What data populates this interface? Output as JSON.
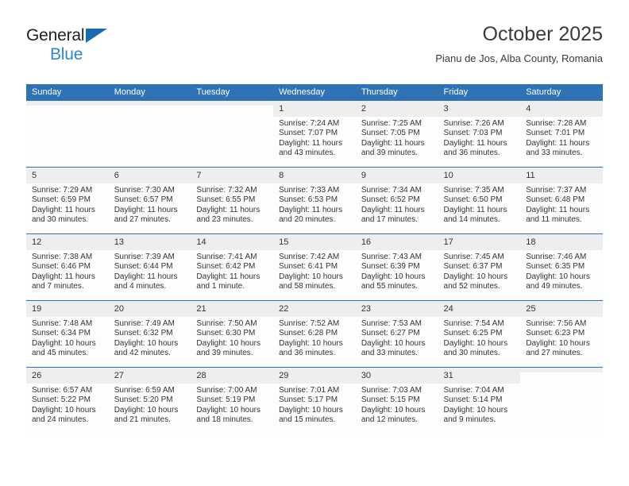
{
  "brand": {
    "name_top": "General",
    "name_bottom": "Blue",
    "triangle_color": "#1b68b3",
    "text_color_top": "#231f20",
    "text_color_bottom": "#2e86d4"
  },
  "header": {
    "title": "October 2025",
    "subtitle": "Pianu de Jos, Alba County, Romania"
  },
  "theme": {
    "header_bg": "#2f72b6",
    "header_text": "#ffffff",
    "daynum_bg": "#eeeeee",
    "cell_bg": "#fdfdfd",
    "border": "#2f72b6",
    "text": "#333333"
  },
  "weekdays": [
    "Sunday",
    "Monday",
    "Tuesday",
    "Wednesday",
    "Thursday",
    "Friday",
    "Saturday"
  ],
  "labels": {
    "sunrise": "Sunrise:",
    "sunset": "Sunset:",
    "daylight": "Daylight:"
  },
  "weeks": [
    [
      {
        "day": "",
        "empty": true
      },
      {
        "day": "",
        "empty": true
      },
      {
        "day": "",
        "empty": true
      },
      {
        "day": "1",
        "sunrise": "Sunrise: 7:24 AM",
        "sunset": "Sunset: 7:07 PM",
        "daylight": "Daylight: 11 hours and 43 minutes."
      },
      {
        "day": "2",
        "sunrise": "Sunrise: 7:25 AM",
        "sunset": "Sunset: 7:05 PM",
        "daylight": "Daylight: 11 hours and 39 minutes."
      },
      {
        "day": "3",
        "sunrise": "Sunrise: 7:26 AM",
        "sunset": "Sunset: 7:03 PM",
        "daylight": "Daylight: 11 hours and 36 minutes."
      },
      {
        "day": "4",
        "sunrise": "Sunrise: 7:28 AM",
        "sunset": "Sunset: 7:01 PM",
        "daylight": "Daylight: 11 hours and 33 minutes."
      }
    ],
    [
      {
        "day": "5",
        "sunrise": "Sunrise: 7:29 AM",
        "sunset": "Sunset: 6:59 PM",
        "daylight": "Daylight: 11 hours and 30 minutes."
      },
      {
        "day": "6",
        "sunrise": "Sunrise: 7:30 AM",
        "sunset": "Sunset: 6:57 PM",
        "daylight": "Daylight: 11 hours and 27 minutes."
      },
      {
        "day": "7",
        "sunrise": "Sunrise: 7:32 AM",
        "sunset": "Sunset: 6:55 PM",
        "daylight": "Daylight: 11 hours and 23 minutes."
      },
      {
        "day": "8",
        "sunrise": "Sunrise: 7:33 AM",
        "sunset": "Sunset: 6:53 PM",
        "daylight": "Daylight: 11 hours and 20 minutes."
      },
      {
        "day": "9",
        "sunrise": "Sunrise: 7:34 AM",
        "sunset": "Sunset: 6:52 PM",
        "daylight": "Daylight: 11 hours and 17 minutes."
      },
      {
        "day": "10",
        "sunrise": "Sunrise: 7:35 AM",
        "sunset": "Sunset: 6:50 PM",
        "daylight": "Daylight: 11 hours and 14 minutes."
      },
      {
        "day": "11",
        "sunrise": "Sunrise: 7:37 AM",
        "sunset": "Sunset: 6:48 PM",
        "daylight": "Daylight: 11 hours and 11 minutes."
      }
    ],
    [
      {
        "day": "12",
        "sunrise": "Sunrise: 7:38 AM",
        "sunset": "Sunset: 6:46 PM",
        "daylight": "Daylight: 11 hours and 7 minutes."
      },
      {
        "day": "13",
        "sunrise": "Sunrise: 7:39 AM",
        "sunset": "Sunset: 6:44 PM",
        "daylight": "Daylight: 11 hours and 4 minutes."
      },
      {
        "day": "14",
        "sunrise": "Sunrise: 7:41 AM",
        "sunset": "Sunset: 6:42 PM",
        "daylight": "Daylight: 11 hours and 1 minute."
      },
      {
        "day": "15",
        "sunrise": "Sunrise: 7:42 AM",
        "sunset": "Sunset: 6:41 PM",
        "daylight": "Daylight: 10 hours and 58 minutes."
      },
      {
        "day": "16",
        "sunrise": "Sunrise: 7:43 AM",
        "sunset": "Sunset: 6:39 PM",
        "daylight": "Daylight: 10 hours and 55 minutes."
      },
      {
        "day": "17",
        "sunrise": "Sunrise: 7:45 AM",
        "sunset": "Sunset: 6:37 PM",
        "daylight": "Daylight: 10 hours and 52 minutes."
      },
      {
        "day": "18",
        "sunrise": "Sunrise: 7:46 AM",
        "sunset": "Sunset: 6:35 PM",
        "daylight": "Daylight: 10 hours and 49 minutes."
      }
    ],
    [
      {
        "day": "19",
        "sunrise": "Sunrise: 7:48 AM",
        "sunset": "Sunset: 6:34 PM",
        "daylight": "Daylight: 10 hours and 45 minutes."
      },
      {
        "day": "20",
        "sunrise": "Sunrise: 7:49 AM",
        "sunset": "Sunset: 6:32 PM",
        "daylight": "Daylight: 10 hours and 42 minutes."
      },
      {
        "day": "21",
        "sunrise": "Sunrise: 7:50 AM",
        "sunset": "Sunset: 6:30 PM",
        "daylight": "Daylight: 10 hours and 39 minutes."
      },
      {
        "day": "22",
        "sunrise": "Sunrise: 7:52 AM",
        "sunset": "Sunset: 6:28 PM",
        "daylight": "Daylight: 10 hours and 36 minutes."
      },
      {
        "day": "23",
        "sunrise": "Sunrise: 7:53 AM",
        "sunset": "Sunset: 6:27 PM",
        "daylight": "Daylight: 10 hours and 33 minutes."
      },
      {
        "day": "24",
        "sunrise": "Sunrise: 7:54 AM",
        "sunset": "Sunset: 6:25 PM",
        "daylight": "Daylight: 10 hours and 30 minutes."
      },
      {
        "day": "25",
        "sunrise": "Sunrise: 7:56 AM",
        "sunset": "Sunset: 6:23 PM",
        "daylight": "Daylight: 10 hours and 27 minutes."
      }
    ],
    [
      {
        "day": "26",
        "sunrise": "Sunrise: 6:57 AM",
        "sunset": "Sunset: 5:22 PM",
        "daylight": "Daylight: 10 hours and 24 minutes."
      },
      {
        "day": "27",
        "sunrise": "Sunrise: 6:59 AM",
        "sunset": "Sunset: 5:20 PM",
        "daylight": "Daylight: 10 hours and 21 minutes."
      },
      {
        "day": "28",
        "sunrise": "Sunrise: 7:00 AM",
        "sunset": "Sunset: 5:19 PM",
        "daylight": "Daylight: 10 hours and 18 minutes."
      },
      {
        "day": "29",
        "sunrise": "Sunrise: 7:01 AM",
        "sunset": "Sunset: 5:17 PM",
        "daylight": "Daylight: 10 hours and 15 minutes."
      },
      {
        "day": "30",
        "sunrise": "Sunrise: 7:03 AM",
        "sunset": "Sunset: 5:15 PM",
        "daylight": "Daylight: 10 hours and 12 minutes."
      },
      {
        "day": "31",
        "sunrise": "Sunrise: 7:04 AM",
        "sunset": "Sunset: 5:14 PM",
        "daylight": "Daylight: 10 hours and 9 minutes."
      },
      {
        "day": "",
        "empty": true
      }
    ]
  ]
}
